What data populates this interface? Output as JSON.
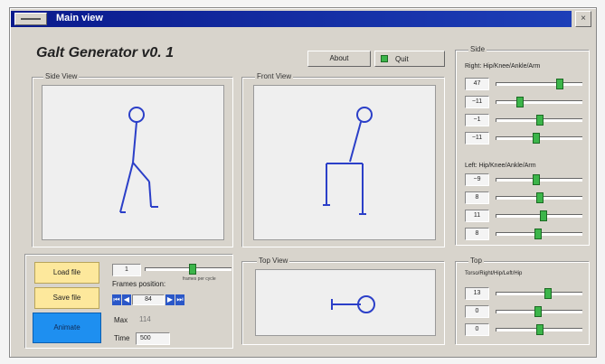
{
  "window": {
    "title": "Main view"
  },
  "app": {
    "name": "Galt Generator v0. 1"
  },
  "buttons": {
    "about": "About",
    "quit": "Quit",
    "load": "Load file",
    "save": "Save file",
    "animate": "Animate"
  },
  "panels": {
    "side_view": "Side View",
    "front_view": "Front View",
    "top_view": "Top View",
    "side": "Side",
    "top": "Top"
  },
  "side_panel": {
    "right_label": "Right: Hip/Knee/Ankle/Arm",
    "right_values": [
      "47",
      "−11",
      "−1",
      "−11"
    ],
    "right_levels": [
      0.75,
      0.25,
      0.5,
      0.45
    ],
    "left_label": "Left: Hip/Knee/Ankle/Arm",
    "left_values": [
      "−9",
      "8",
      "11",
      "8"
    ],
    "left_levels": [
      0.45,
      0.5,
      0.55,
      0.48
    ]
  },
  "top_panel": {
    "label": "Torso/Right/Hip/Left/Hip",
    "values": [
      "13",
      "0",
      "0"
    ],
    "levels": [
      0.6,
      0.48,
      0.5
    ]
  },
  "frames": {
    "value": "1",
    "level": 0.55,
    "hint": "frames per cycle",
    "position_label": "Frames position:",
    "position_value": "84",
    "max_label": "Max",
    "max_value": "114",
    "time_label": "Time",
    "time_value": "500"
  },
  "colors": {
    "title_bar": "#0a1a8c",
    "slider_thumb": "#3cb54a",
    "figure": "#2b3fc8",
    "quit_led": "#3cb54a",
    "animate_btn": "#1e8ff0"
  }
}
